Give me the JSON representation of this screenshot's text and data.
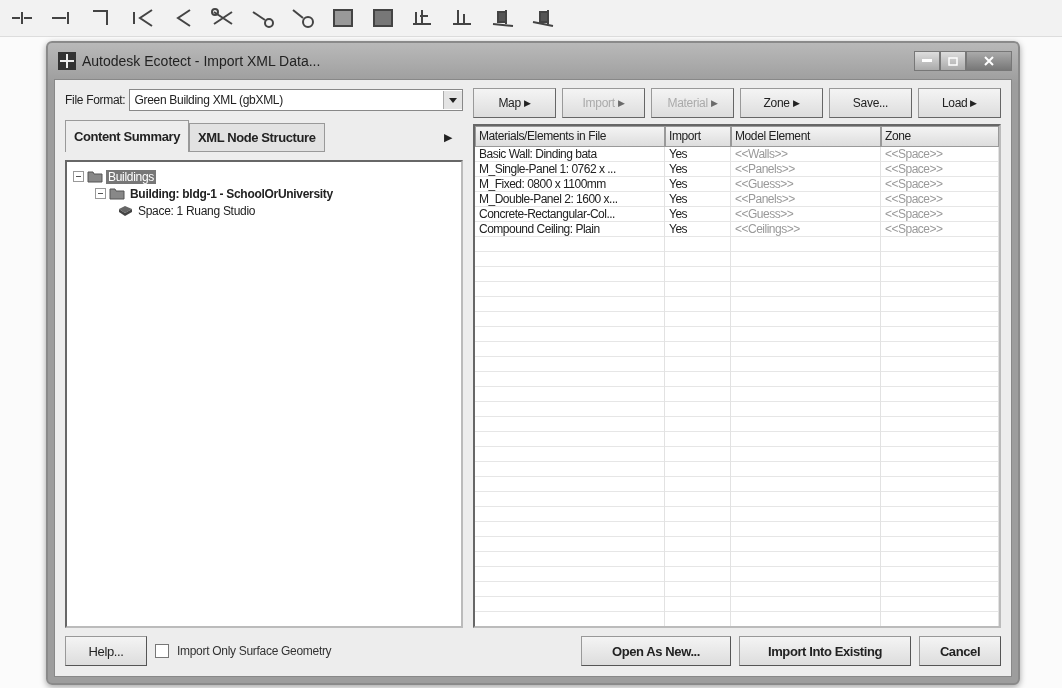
{
  "window": {
    "title": "Autodesk Ecotect - Import XML Data..."
  },
  "file_format": {
    "label": "File Format:",
    "value": "Green Building XML (gbXML)"
  },
  "tabs": [
    {
      "label": "Content Summary",
      "selected": true
    },
    {
      "label": "XML Node Structure",
      "selected": false
    }
  ],
  "tab_scroll": "▶",
  "tree": [
    {
      "label": "Buildings",
      "kind": "folder",
      "selected": true,
      "expanded": true,
      "children": [
        {
          "label": "Building: bldg-1 - SchoolOrUniversity",
          "kind": "folder",
          "selected": false,
          "expanded": true,
          "children": [
            {
              "label": "Space: 1 Ruang Studio",
              "kind": "space",
              "selected": false
            }
          ]
        }
      ]
    }
  ],
  "toolbar": [
    {
      "label": "Map",
      "arrow": "▶",
      "disabled": false
    },
    {
      "label": "Import",
      "arrow": "▶",
      "disabled": true
    },
    {
      "label": "Material",
      "arrow": "▶",
      "disabled": true
    },
    {
      "label": "Zone",
      "arrow": "▶",
      "disabled": false
    },
    {
      "label": "Save...",
      "disabled": false
    },
    {
      "label": "Load",
      "arrow": "▶",
      "disabled": false
    }
  ],
  "table": {
    "columns": [
      "Materials/Elements in File",
      "Import",
      "Model Element",
      "Zone"
    ],
    "rows": [
      [
        "Basic Wall: Dinding bata",
        "Yes",
        "<<Walls>>",
        "<<Space>>"
      ],
      [
        "M_Single-Panel 1: 0762 x ...",
        "Yes",
        "<<Panels>>",
        "<<Space>>"
      ],
      [
        "M_Fixed: 0800 x 1100mm",
        "Yes",
        "<<Guess>>",
        "<<Space>>"
      ],
      [
        "M_Double-Panel 2: 1600 x...",
        "Yes",
        "<<Panels>>",
        "<<Space>>"
      ],
      [
        "Concrete-Rectangular-Col...",
        "Yes",
        "<<Guess>>",
        "<<Space>>"
      ],
      [
        "Compound Ceiling: Plain",
        "Yes",
        "<<Ceilings>>",
        "<<Space>>"
      ]
    ]
  },
  "help_button": "Help...",
  "surface_only": {
    "label": "Import Only Surface Geometry",
    "checked": false
  },
  "buttons": [
    "Open As New...",
    "Import Into Existing",
    "Cancel"
  ]
}
